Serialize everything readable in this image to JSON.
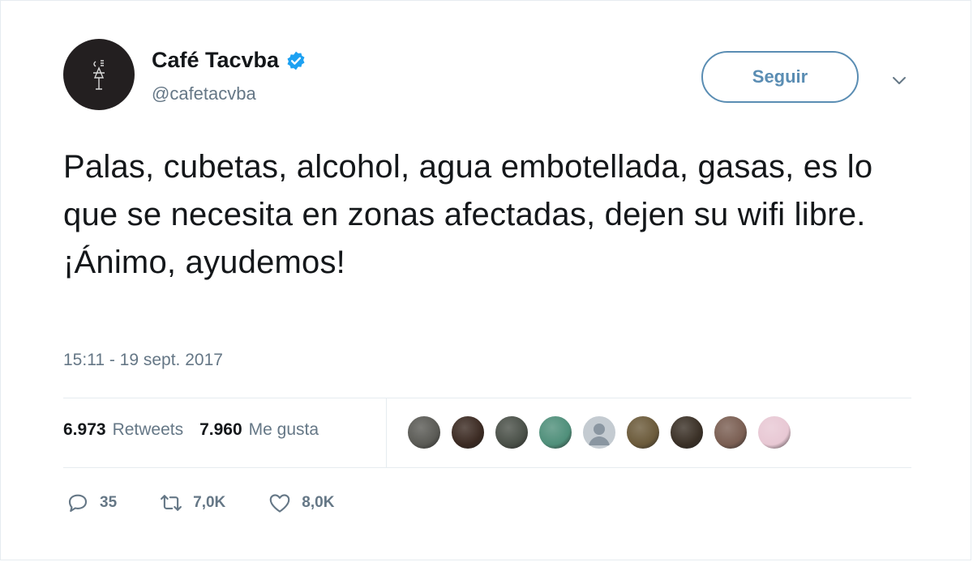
{
  "user": {
    "name": "Café Tacvba",
    "handle": "@cafetacvba",
    "verified_icon": "verified-badge-icon"
  },
  "follow_button": {
    "label": "Seguir"
  },
  "tweet": {
    "text": "Palas, cubetas, alcohol, agua embotellada, gasas, es lo que se necesita en zonas afectadas, dejen su wifi libre. ¡Ánimo, ayudemos!",
    "timestamp": "15:11 - 19 sept. 2017"
  },
  "stats": {
    "retweets_count": "6.973",
    "retweets_label": "Retweets",
    "likes_count": "7.960",
    "likes_label": "Me gusta"
  },
  "liker_avatars": [
    "#5a5a55",
    "#3b2a22",
    "#4a5048",
    "#4f8f7a",
    "#c4cbd1",
    "#6b5a3a",
    "#3a3026",
    "#7a5e52",
    "#e8c8d4"
  ],
  "actions": {
    "reply_count": "35",
    "retweet_count": "7,0K",
    "like_count": "8,0K"
  },
  "colors": {
    "accent": "#1da1f2",
    "follow_border": "#5a8db3",
    "secondary_text": "#657786"
  }
}
